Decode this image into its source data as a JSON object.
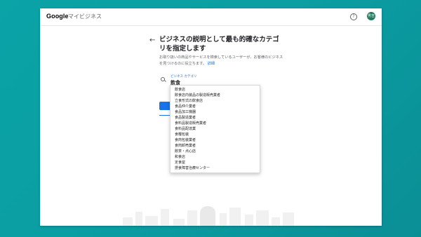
{
  "app": {
    "logo_text": "Google",
    "title": "マイビジネス",
    "help_glyph": "?",
    "avatar_initials": "男吉"
  },
  "colors": {
    "background": "#0aa3a6",
    "accent": "#1a73e8",
    "avatar": "#1e7a5a"
  },
  "icons": {
    "back": "back-arrow-icon",
    "help": "help-circle-icon",
    "search": "search-icon"
  },
  "main": {
    "heading": "ビジネスの説明として最も的確なカテゴリを指定します",
    "description": "お取り扱いの商品やサービスを検索しているユーザーが、お客様のビジネスを見つけるのに役立ちます。",
    "details_link": "詳細",
    "category_field": {
      "label": "ビジネス カテゴリ",
      "value": "飲食"
    },
    "progress_fraction": 0.7
  },
  "dropdown": {
    "options": [
      "飲食店",
      "飲食店内装品の製造販売業者",
      "立食形式の飲食店",
      "食品仲介業者",
      "食品加工機器",
      "食品製造業者",
      "食料品製造販売業者",
      "食料品配達業",
      "食糧包装",
      "食肉包装業者",
      "食肉卸売業者",
      "飲茶・点心店",
      "和食店",
      "定食屋",
      "摂食障害治療センター"
    ]
  }
}
